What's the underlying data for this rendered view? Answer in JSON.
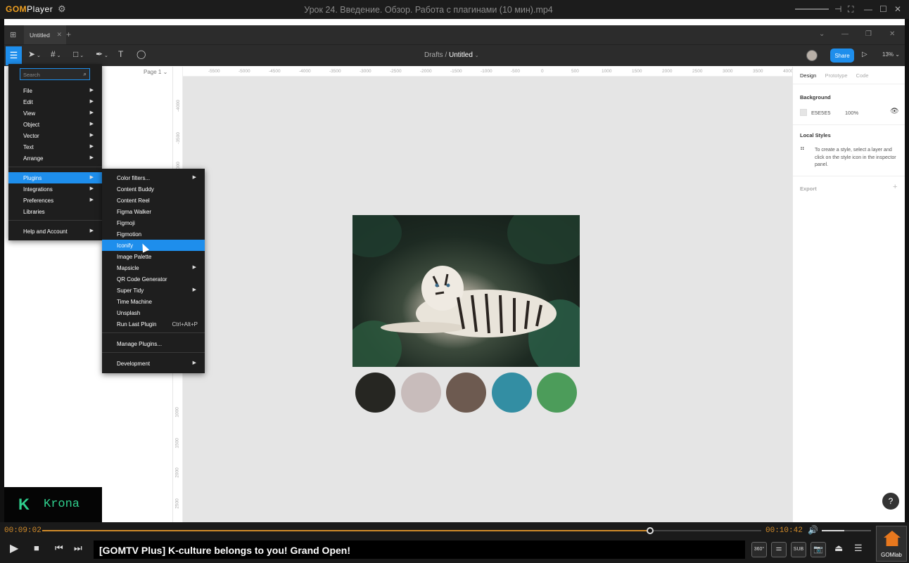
{
  "gom": {
    "brand_gom": "GOM",
    "brand_player": "Player",
    "window_title": "Урок 24. Введение. Обзор. Работа с плагинами (10 мин).mp4",
    "time_current": "00:09:02",
    "time_total": "00:10:42",
    "progress_fraction": 0.845,
    "volume_fraction": 0.45,
    "ticker": "[GOMTV Plus] K-culture belongs to you! Grand Open!",
    "btn_360": "360°",
    "btn_sub": "SUB",
    "gomlab_label": "GOMlab"
  },
  "figma": {
    "tab_title": "Untitled",
    "breadcrumb_drafts": "Drafts",
    "breadcrumb_sep": "/",
    "breadcrumb_file": "Untitled",
    "share_label": "Share",
    "zoom_label": "13%",
    "page_label": "Page 1",
    "search_placeholder": "Search",
    "main_menu": [
      {
        "label": "File",
        "sub": true
      },
      {
        "label": "Edit",
        "sub": true
      },
      {
        "label": "View",
        "sub": true
      },
      {
        "label": "Object",
        "sub": true
      },
      {
        "label": "Vector",
        "sub": true
      },
      {
        "label": "Text",
        "sub": true
      },
      {
        "label": "Arrange",
        "sub": true
      },
      {
        "label": "Plugins",
        "sub": true
      },
      {
        "label": "Integrations",
        "sub": true
      },
      {
        "label": "Preferences",
        "sub": true
      },
      {
        "label": "Libraries",
        "sub": false
      },
      {
        "label": "Help and Account",
        "sub": true
      }
    ],
    "plugins_menu": [
      {
        "label": "Color filters...",
        "sub": true
      },
      {
        "label": "Content Buddy",
        "sub": false
      },
      {
        "label": "Content Reel",
        "sub": false
      },
      {
        "label": "Figma Walker",
        "sub": false
      },
      {
        "label": "Figmoji",
        "sub": false
      },
      {
        "label": "Figmotion",
        "sub": false
      },
      {
        "label": "Iconify",
        "sub": false
      },
      {
        "label": "Image Palette",
        "sub": false
      },
      {
        "label": "Mapsicle",
        "sub": true
      },
      {
        "label": "QR Code Generator",
        "sub": false
      },
      {
        "label": "Super Tidy",
        "sub": true
      },
      {
        "label": "Time Machine",
        "sub": false
      },
      {
        "label": "Unsplash",
        "sub": false
      },
      {
        "label": "Run Last Plugin",
        "shortcut": "Ctrl+Alt+P"
      },
      {
        "label": "Manage Plugins...",
        "sub": false
      },
      {
        "label": "Development",
        "sub": true
      }
    ],
    "ruler_h": [
      "-5500",
      "-5000",
      "-4500",
      "-4000",
      "-3500",
      "-3000",
      "-2500",
      "-2000",
      "-1500",
      "-1000",
      "-500",
      "0",
      "500",
      "1000",
      "1500",
      "2000",
      "2500",
      "3000",
      "3500",
      "4000"
    ],
    "ruler_v": [
      "-4000",
      "-3500",
      "-3000",
      "1000",
      "1500",
      "2000",
      "2500"
    ],
    "palette_colors": [
      "#262622",
      "#c8bcbb",
      "#6d5a50",
      "#338ea3",
      "#4c9c5a"
    ],
    "right_panel": {
      "tab_design": "Design",
      "tab_prototype": "Prototype",
      "tab_code": "Code",
      "background_title": "Background",
      "bg_hex": "E5E5E5",
      "bg_opacity": "100%",
      "local_styles_title": "Local Styles",
      "local_styles_hint": "To create a style, select a layer and click on the style icon in the inspector panel.",
      "export_title": "Export",
      "help_label": "?"
    }
  },
  "watermark": {
    "text": "Krona"
  }
}
